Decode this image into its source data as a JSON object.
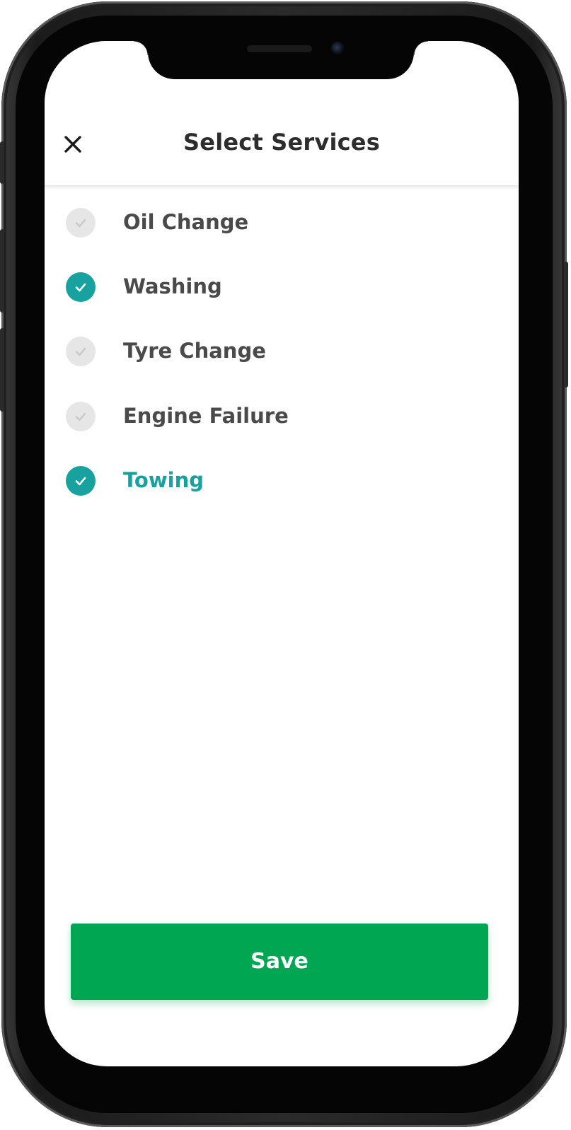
{
  "header": {
    "title": "Select Services",
    "close_icon": "close-icon"
  },
  "services": [
    {
      "label": "Oil Change",
      "selected": false
    },
    {
      "label": "Washing",
      "selected": true
    },
    {
      "label": "Tyre Change",
      "selected": false
    },
    {
      "label": "Engine Failure",
      "selected": false
    },
    {
      "label": "Towing",
      "selected": true,
      "highlighted": true
    }
  ],
  "actions": {
    "save_label": "Save"
  },
  "colors": {
    "accent_teal": "#17a2a0",
    "save_green": "#00a651",
    "unchecked_gray": "#e6e6e6",
    "text_dark": "#4a4a4a"
  }
}
